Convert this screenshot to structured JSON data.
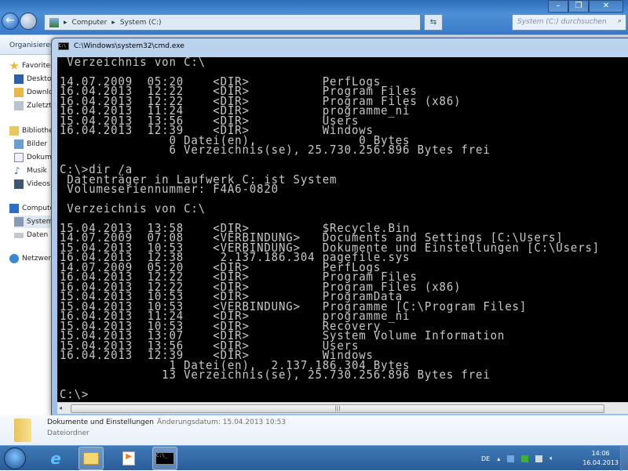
{
  "explorer": {
    "breadcrumb": [
      "Computer",
      "System (C:)"
    ],
    "search_placeholder": "System (C:) durchsuchen",
    "toolbar_organize": "Organisieren",
    "nav": {
      "favorites": "Favoriten",
      "desktop": "Desktop",
      "downloads": "Downloads",
      "recent": "Zuletzt besucht",
      "libraries": "Bibliotheken",
      "pictures": "Bilder",
      "documents": "Dokumente",
      "music": "Musik",
      "videos": "Videos",
      "computer": "Computer",
      "system": "System (C:)",
      "data": "Daten",
      "network": "Netzwerk"
    },
    "details": {
      "name": "Dokumente und Einstellungen",
      "modified": "Änderungsdatum: 15.04.2013 10:53",
      "type": "Dateiordner"
    }
  },
  "cmd": {
    "title": "C:\\Windows\\system32\\cmd.exe",
    "lines": [
      " Verzeichnis von C:\\",
      "",
      "14.07.2009  05:20    <DIR>          PerfLogs",
      "16.04.2013  12:22    <DIR>          Program Files",
      "16.04.2013  12:22    <DIR>          Program Files (x86)",
      "16.04.2013  11:24    <DIR>          programme_ni",
      "15.04.2013  13:56    <DIR>          Users",
      "16.04.2013  12:39    <DIR>          Windows",
      "               0 Datei(en),              0 Bytes",
      "               6 Verzeichnis(se), 25.730.256.896 Bytes frei",
      "",
      "C:\\>dir /a",
      " Datenträger in Laufwerk C: ist System",
      " Volumeseriennummer: F4A6-0820",
      "",
      " Verzeichnis von C:\\",
      "",
      "15.04.2013  13:58    <DIR>          $Recycle.Bin",
      "14.07.2009  07:08    <VERBINDUNG>   Documents and Settings [C:\\Users]",
      "15.04.2013  10:53    <VERBINDUNG>   Dokumente und Einstellungen [C:\\Users]",
      "16.04.2013  12:38     2.137.186.304 pagefile.sys",
      "14.07.2009  05:20    <DIR>          PerfLogs",
      "16.04.2013  12:22    <DIR>          Program Files",
      "16.04.2013  12:22    <DIR>          Program Files (x86)",
      "15.04.2013  10:53    <DIR>          ProgramData",
      "15.04.2013  10:53    <VERBINDUNG>   Programme [C:\\Program Files]",
      "16.04.2013  11:24    <DIR>          programme_ni",
      "15.04.2013  10:53    <DIR>          Recovery",
      "15.04.2013  13:07    <DIR>          System Volume Information",
      "15.04.2013  13:56    <DIR>          Users",
      "16.04.2013  12:39    <DIR>          Windows",
      "               1 Datei(en),  2.137.186.304 Bytes",
      "              13 Verzeichnis(se), 25.730.256.896 Bytes frei",
      "",
      "C:\\>"
    ]
  },
  "taskbar": {
    "language": "DE",
    "time": "14:06",
    "date": "16.04.2013"
  }
}
